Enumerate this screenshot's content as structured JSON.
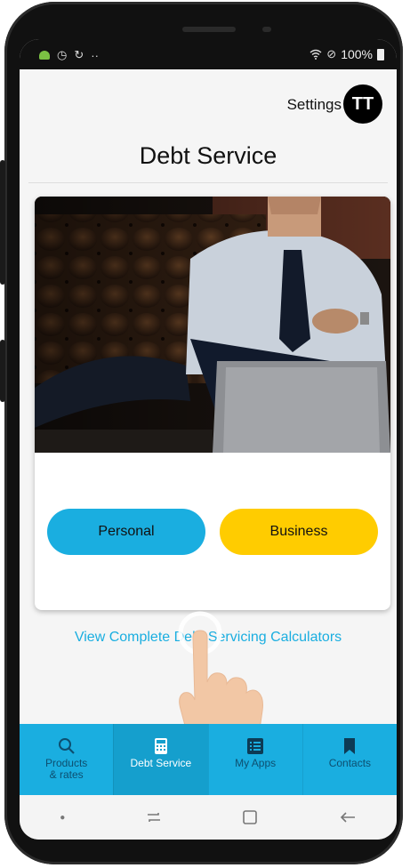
{
  "status_bar": {
    "right_text": "100%",
    "icons": [
      "android-icon",
      "timer-icon",
      "refresh-icon",
      "more-icon",
      "wifi-icon",
      "no-sim-icon",
      "battery-icon"
    ]
  },
  "header": {
    "settings_label": "Settings",
    "avatar_initials": "TT"
  },
  "page": {
    "title": "Debt Service"
  },
  "card": {
    "image": "businessman-laptop-photo",
    "buttons": {
      "personal": "Personal",
      "business": "Business"
    }
  },
  "link": {
    "text": "View Complete Debt Servicing Calculators"
  },
  "bottom_nav": [
    {
      "label": "Products\n& rates",
      "icon": "search-icon",
      "active": false
    },
    {
      "label": "Debt Service",
      "icon": "calculator-icon",
      "active": true
    },
    {
      "label": "My Apps",
      "icon": "list-icon",
      "active": false
    },
    {
      "label": "Contacts",
      "icon": "bookmark-icon",
      "active": false
    }
  ],
  "colors": {
    "accent_blue": "#1aaee0",
    "accent_yellow": "#ffcc00"
  }
}
